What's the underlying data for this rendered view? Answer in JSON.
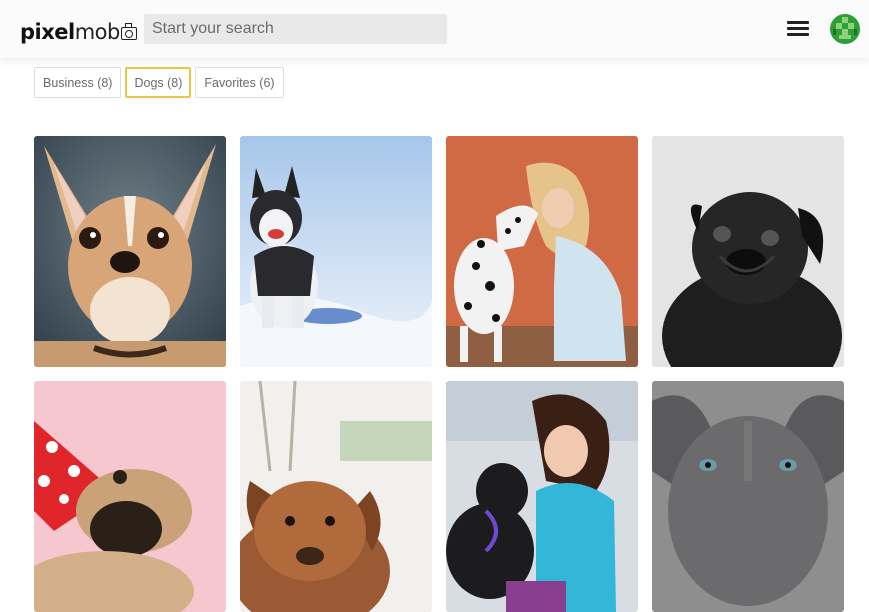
{
  "header": {
    "logo_text_bold": "pixel",
    "logo_text_light": "mob",
    "search_placeholder": "Start your search",
    "menu_icon": "hamburger-menu-icon",
    "avatar_icon": "avatar"
  },
  "tabs": [
    {
      "label": "Business (8)",
      "active": false
    },
    {
      "label": "Dogs (8)",
      "active": true
    },
    {
      "label": "Favorites (6)",
      "active": false
    }
  ],
  "colors": {
    "accent": "#edc544",
    "header_bg": "#fbfbfb",
    "search_bg": "#e9e9e9",
    "avatar_green": "#2e9e36"
  },
  "gallery": {
    "photos": [
      {
        "subject": "chihuahua"
      },
      {
        "subject": "husky puppy in snow"
      },
      {
        "subject": "dalmatian kissing girl"
      },
      {
        "subject": "black pug"
      },
      {
        "subject": "pug with party hat"
      },
      {
        "subject": "brown puppy"
      },
      {
        "subject": "girl hugging black dog"
      },
      {
        "subject": "grey pit bull"
      }
    ]
  }
}
